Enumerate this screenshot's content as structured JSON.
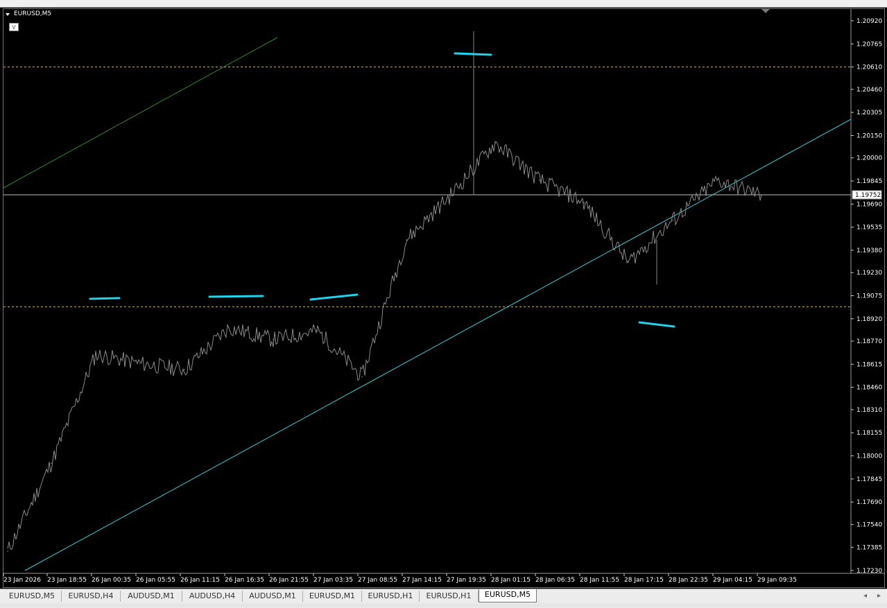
{
  "window": {
    "chart_title": "EURUSD,M5",
    "visibility_badge": "V"
  },
  "toolbar": {
    "icons": [
      "cursor-icon",
      "crosshair-icon",
      "vertical-line-icon",
      "horizontal-line-icon",
      "trendline-icon",
      "fibo-icon",
      "text-icon",
      "arrow-icon",
      "rectangle-icon",
      "ellipse-icon",
      "shapes-icon"
    ]
  },
  "price_axis": {
    "labels": [
      "1.20920",
      "1.20765",
      "1.20610",
      "1.20460",
      "1.20305",
      "1.20150",
      "1.20000",
      "1.19845",
      "1.19690",
      "1.19535",
      "1.19380",
      "1.19230",
      "1.19075",
      "1.18920",
      "1.18770",
      "1.18615",
      "1.18460",
      "1.18310",
      "1.18155",
      "1.18000",
      "1.17845",
      "1.17690",
      "1.17540",
      "1.17385",
      "1.17230"
    ],
    "current_price": "1.19752"
  },
  "time_axis": {
    "labels": [
      "23 Jan 2026",
      "23 Jan 18:55",
      "26 Jan 00:35",
      "26 Jan 05:55",
      "26 Jan 11:15",
      "26 Jan 16:35",
      "26 Jan 21:55",
      "27 Jan 03:35",
      "27 Jan 08:55",
      "27 Jan 14:15",
      "27 Jan 19:35",
      "28 Jan 01:15",
      "28 Jan 06:35",
      "28 Jan 11:55",
      "28 Jan 17:15",
      "28 Jan 22:35",
      "29 Jan 04:15",
      "29 Jan 09:35"
    ]
  },
  "horizontal_levels": [
    {
      "price": 1.2061,
      "style": "dashed",
      "color": "#d9b25a"
    },
    {
      "price": 1.19752,
      "style": "solid",
      "color": "#c0c0c0"
    },
    {
      "price": 1.19,
      "style": "dashed",
      "color": "#d9b25a"
    }
  ],
  "colors": {
    "background": "#000000",
    "price_line": "#8a8a8a",
    "trendline": "#3ec9d6",
    "green_line": "#2e8b2e",
    "marker": "#22d3ee",
    "axis_text": "#ffffff"
  },
  "chart_data": {
    "type": "line",
    "symbol": "EURUSD",
    "timeframe": "M5",
    "ylim": [
      1.1723,
      1.2092
    ],
    "x": [
      "23 Jan 2026",
      "23 Jan 18:55",
      "26 Jan 00:35",
      "26 Jan 05:55",
      "26 Jan 11:15",
      "26 Jan 16:35",
      "26 Jan 21:55",
      "27 Jan 03:35",
      "27 Jan 08:55",
      "27 Jan 14:15",
      "27 Jan 19:35",
      "28 Jan 01:15",
      "28 Jan 06:35",
      "28 Jan 11:55",
      "28 Jan 17:15",
      "28 Jan 22:35",
      "29 Jan 04:15",
      "29 Jan 09:35"
    ],
    "series": [
      {
        "values": [
          1.1736,
          1.1795,
          1.1868,
          1.1862,
          1.1858,
          1.1886,
          1.1878,
          1.1884,
          1.1853,
          1.1945,
          1.1975,
          1.201,
          1.1985,
          1.197,
          1.193,
          1.1958,
          1.1985,
          1.1975
        ]
      }
    ],
    "annotations": [
      {
        "type": "trendline",
        "from": [
          "23 Jan 2026",
          1.1723
        ],
        "to": [
          "29 Jan 09:35",
          1.2023
        ]
      }
    ]
  }
}
